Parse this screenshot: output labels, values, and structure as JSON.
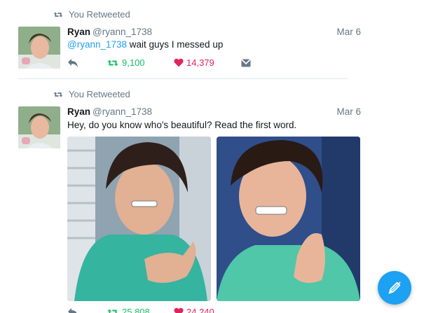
{
  "colors": {
    "accent": "#1da1f2",
    "retweet_green": "#17bf63",
    "like_red": "#e0245e",
    "muted": "#657786"
  },
  "tweets": [
    {
      "retweet_label": "You Retweeted",
      "name": "Ryan",
      "handle": "@ryann_1738",
      "date": "Mar 6",
      "mention": "@ryann_1738",
      "text": " wait guys I messed up",
      "retweets": "9,100",
      "likes": "14,379",
      "icons": [
        "retweet-icon",
        "reply-icon",
        "like-icon",
        "message-icon"
      ]
    },
    {
      "retweet_label": "You Retweeted",
      "name": "Ryan",
      "handle": "@ryann_1738",
      "date": "Mar 6",
      "text": "Hey, do you know who's beautiful? Read the first word.",
      "retweets": "25,808",
      "likes": "24,240",
      "photos": 2
    }
  ],
  "compose": {
    "icon": "compose-icon"
  }
}
